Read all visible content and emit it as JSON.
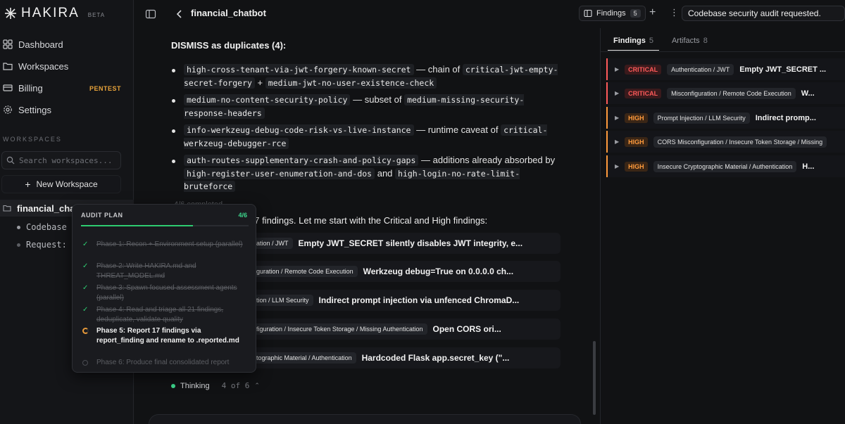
{
  "app": {
    "brand": "HAKIRA",
    "beta": "BETA"
  },
  "sidebar": {
    "nav": [
      {
        "label": "Dashboard",
        "icon": "grid-icon"
      },
      {
        "label": "Workspaces",
        "icon": "folder-icon"
      },
      {
        "label": "Billing",
        "icon": "card-icon"
      },
      {
        "label": "Settings",
        "icon": "gear-icon"
      }
    ],
    "billing_badge": "PENTEST",
    "workspaces_heading": "WORKSPACES",
    "search_placeholder": "Search workspaces...",
    "new_workspace": "New Workspace",
    "workspace": "financial_chatbot",
    "threads": [
      "Codebase s",
      "Request: C"
    ]
  },
  "topbar": {
    "title": "financial_chatbot",
    "findings_label": "Findings",
    "findings_count": "5",
    "status": "Codebase security audit requested."
  },
  "right_panel": {
    "tabs": [
      {
        "label": "Findings",
        "count": "5"
      },
      {
        "label": "Artifacts",
        "count": "8"
      }
    ],
    "findings": [
      {
        "severity": "CRITICAL",
        "category": "Authentication / JWT",
        "title": "Empty JWT_SECRET ..."
      },
      {
        "severity": "CRITICAL",
        "category": "Misconfiguration / Remote Code Execution",
        "title": "W..."
      },
      {
        "severity": "HIGH",
        "category": "Prompt Injection / LLM Security",
        "title": "Indirect promp..."
      },
      {
        "severity": "HIGH",
        "category": "CORS Misconfiguration / Insecure Token Storage / Missing",
        "title": ""
      },
      {
        "severity": "HIGH",
        "category": "Insecure Cryptographic Material / Authentication",
        "title": "H..."
      }
    ]
  },
  "chat": {
    "dismiss_heading": "DISMISS as duplicates (4):",
    "bullets": [
      {
        "code1": "high-cross-tenant-via-jwt-forgery-known-secret",
        "t1": " — chain of ",
        "code2": "critical-jwt-empty-secret-forgery",
        "t2": " + ",
        "code3": "medium-jwt-no-user-existence-check",
        "t3": ""
      },
      {
        "code1": "medium-no-content-security-policy",
        "t1": " — subset of ",
        "code2": "medium-missing-security-response-headers",
        "t2": "",
        "code3": "",
        "t3": ""
      },
      {
        "code1": "info-werkzeug-debug-code-risk-vs-live-instance",
        "t1": " — runtime caveat of ",
        "code2": "critical-werkzeug-debugger-rce",
        "t2": "",
        "code3": "",
        "t3": ""
      },
      {
        "code1": "auth-routes-supplementary-crash-and-policy-gaps",
        "t1": " — additions already absorbed by ",
        "code2": "high-register-user-enumeration-and-dos",
        "t2": " and ",
        "code3": "high-login-no-rate-limit-bruteforce",
        "t3": ""
      }
    ],
    "faded_todo": "4/6 completed",
    "message": "17 findings. Let me start with the Critical and High findings:",
    "finding_rows": [
      {
        "category": "entication / JWT",
        "title": "Empty JWT_SECRET silently disables JWT integrity, e..."
      },
      {
        "category": "configuration / Remote Code Execution",
        "title": "Werkzeug debug=True on 0.0.0.0 ch..."
      },
      {
        "category": "Injection / LLM Security",
        "title": "Indirect prompt injection via unfenced ChromaD..."
      },
      {
        "category": "sconfiguration / Insecure Token Storage / Missing Authentication",
        "title": "Open CORS ori..."
      },
      {
        "category": "Cryptographic Material / Authentication",
        "title": "Hardcoded Flask app.secret_key (\"..."
      }
    ],
    "thinking": "Thinking",
    "thinking_count": "4 of 6"
  },
  "audit_plan": {
    "heading": "AUDIT PLAN",
    "count": "4/6",
    "progress": 0.667,
    "steps": [
      {
        "text": "Phase 1: Recon + Environment setup (parallel)",
        "state": "done"
      },
      {
        "text": "Phase 2: Write HAKIRA.md and THREAT_MODEL.md",
        "state": "done"
      },
      {
        "text": "Phase 3: Spawn focused assessment agents (parallel)",
        "state": "done"
      },
      {
        "text": "Phase 4: Read and triage all 21 findings, deduplicate, validate quality",
        "state": "done"
      },
      {
        "text": "Phase 5: Report 17 findings via report_finding and rename to .reported.md",
        "state": "active"
      },
      {
        "text": "Phase 6: Produce final consolidated report",
        "state": "pending"
      }
    ]
  },
  "colors": {
    "critical": "#ff5a5a",
    "high": "#ff9a3c",
    "accent_green": "#3dd68c"
  }
}
